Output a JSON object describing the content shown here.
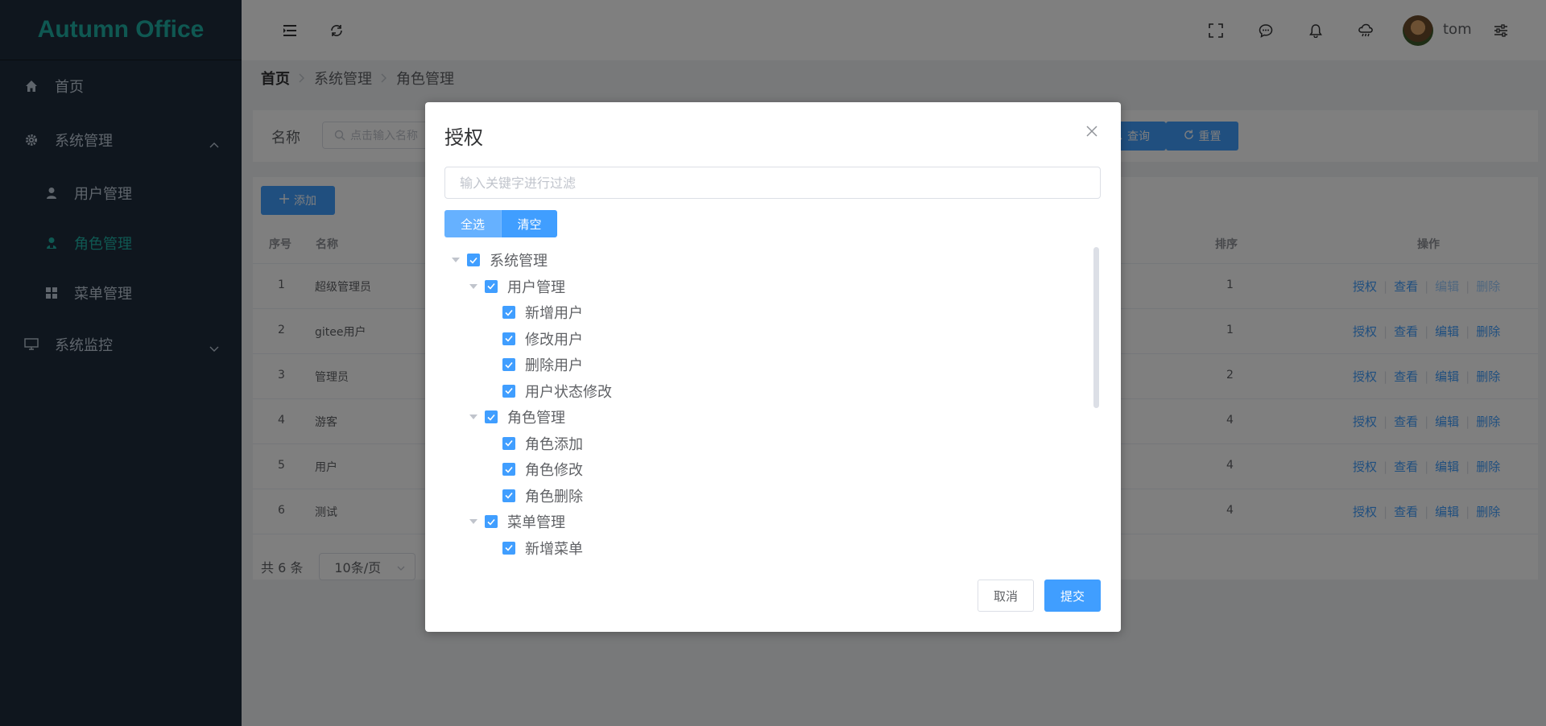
{
  "app": {
    "logo": "Autumn Office"
  },
  "sidebar": {
    "items": [
      {
        "label": "首页",
        "icon": "home-icon"
      },
      {
        "label": "系统管理",
        "icon": "gear-icon",
        "expanded": true,
        "children": [
          {
            "label": "用户管理",
            "icon": "user-icon"
          },
          {
            "label": "角色管理",
            "icon": "role-icon",
            "active": true
          },
          {
            "label": "菜单管理",
            "icon": "grid-icon"
          }
        ]
      },
      {
        "label": "系统监控",
        "icon": "monitor-icon",
        "expanded": false
      }
    ]
  },
  "header": {
    "username": "tom"
  },
  "breadcrumb": {
    "home": "首页",
    "level1": "系统管理",
    "level2": "角色管理"
  },
  "search": {
    "label": "名称",
    "placeholder": "点击输入名称",
    "query_label": "查询",
    "reset_label": "重置"
  },
  "toolbar": {
    "add_label": "添加"
  },
  "table": {
    "columns": {
      "index": "序号",
      "name": "名称",
      "sort": "排序",
      "actions": "操作"
    },
    "rows": [
      {
        "index": "1",
        "name": "超级管理员",
        "sort": "1"
      },
      {
        "index": "2",
        "name": "gitee用户",
        "sort": "1"
      },
      {
        "index": "3",
        "name": "管理员",
        "sort": "2"
      },
      {
        "index": "4",
        "name": "游客",
        "sort": "4"
      },
      {
        "index": "5",
        "name": "用户",
        "sort": "4"
      },
      {
        "index": "6",
        "name": "测试",
        "sort": "4"
      }
    ],
    "actions": {
      "grant": "授权",
      "view": "查看",
      "edit": "编辑",
      "delete": "删除"
    }
  },
  "pagination": {
    "total_text": "共 6 条",
    "page_size": "10条/页"
  },
  "dialog": {
    "title": "授权",
    "filter_placeholder": "输入关键字进行过滤",
    "select_all": "全选",
    "clear": "清空",
    "tree": [
      {
        "label": "系统管理",
        "level": 0,
        "checked": true,
        "expandable": true
      },
      {
        "label": "用户管理",
        "level": 1,
        "checked": true,
        "expandable": true
      },
      {
        "label": "新增用户",
        "level": 2,
        "checked": true
      },
      {
        "label": "修改用户",
        "level": 2,
        "checked": true
      },
      {
        "label": "删除用户",
        "level": 2,
        "checked": true
      },
      {
        "label": "用户状态修改",
        "level": 2,
        "checked": true
      },
      {
        "label": "角色管理",
        "level": 1,
        "checked": true,
        "expandable": true
      },
      {
        "label": "角色添加",
        "level": 2,
        "checked": true
      },
      {
        "label": "角色修改",
        "level": 2,
        "checked": true
      },
      {
        "label": "角色删除",
        "level": 2,
        "checked": true
      },
      {
        "label": "菜单管理",
        "level": 1,
        "checked": true,
        "expandable": true
      },
      {
        "label": "新增菜单",
        "level": 2,
        "checked": true
      }
    ],
    "cancel_label": "取消",
    "submit_label": "提交"
  },
  "colors": {
    "accent": "#409eff",
    "sidebar_bg": "#1f2d3d",
    "logo": "#1fb0a4"
  }
}
